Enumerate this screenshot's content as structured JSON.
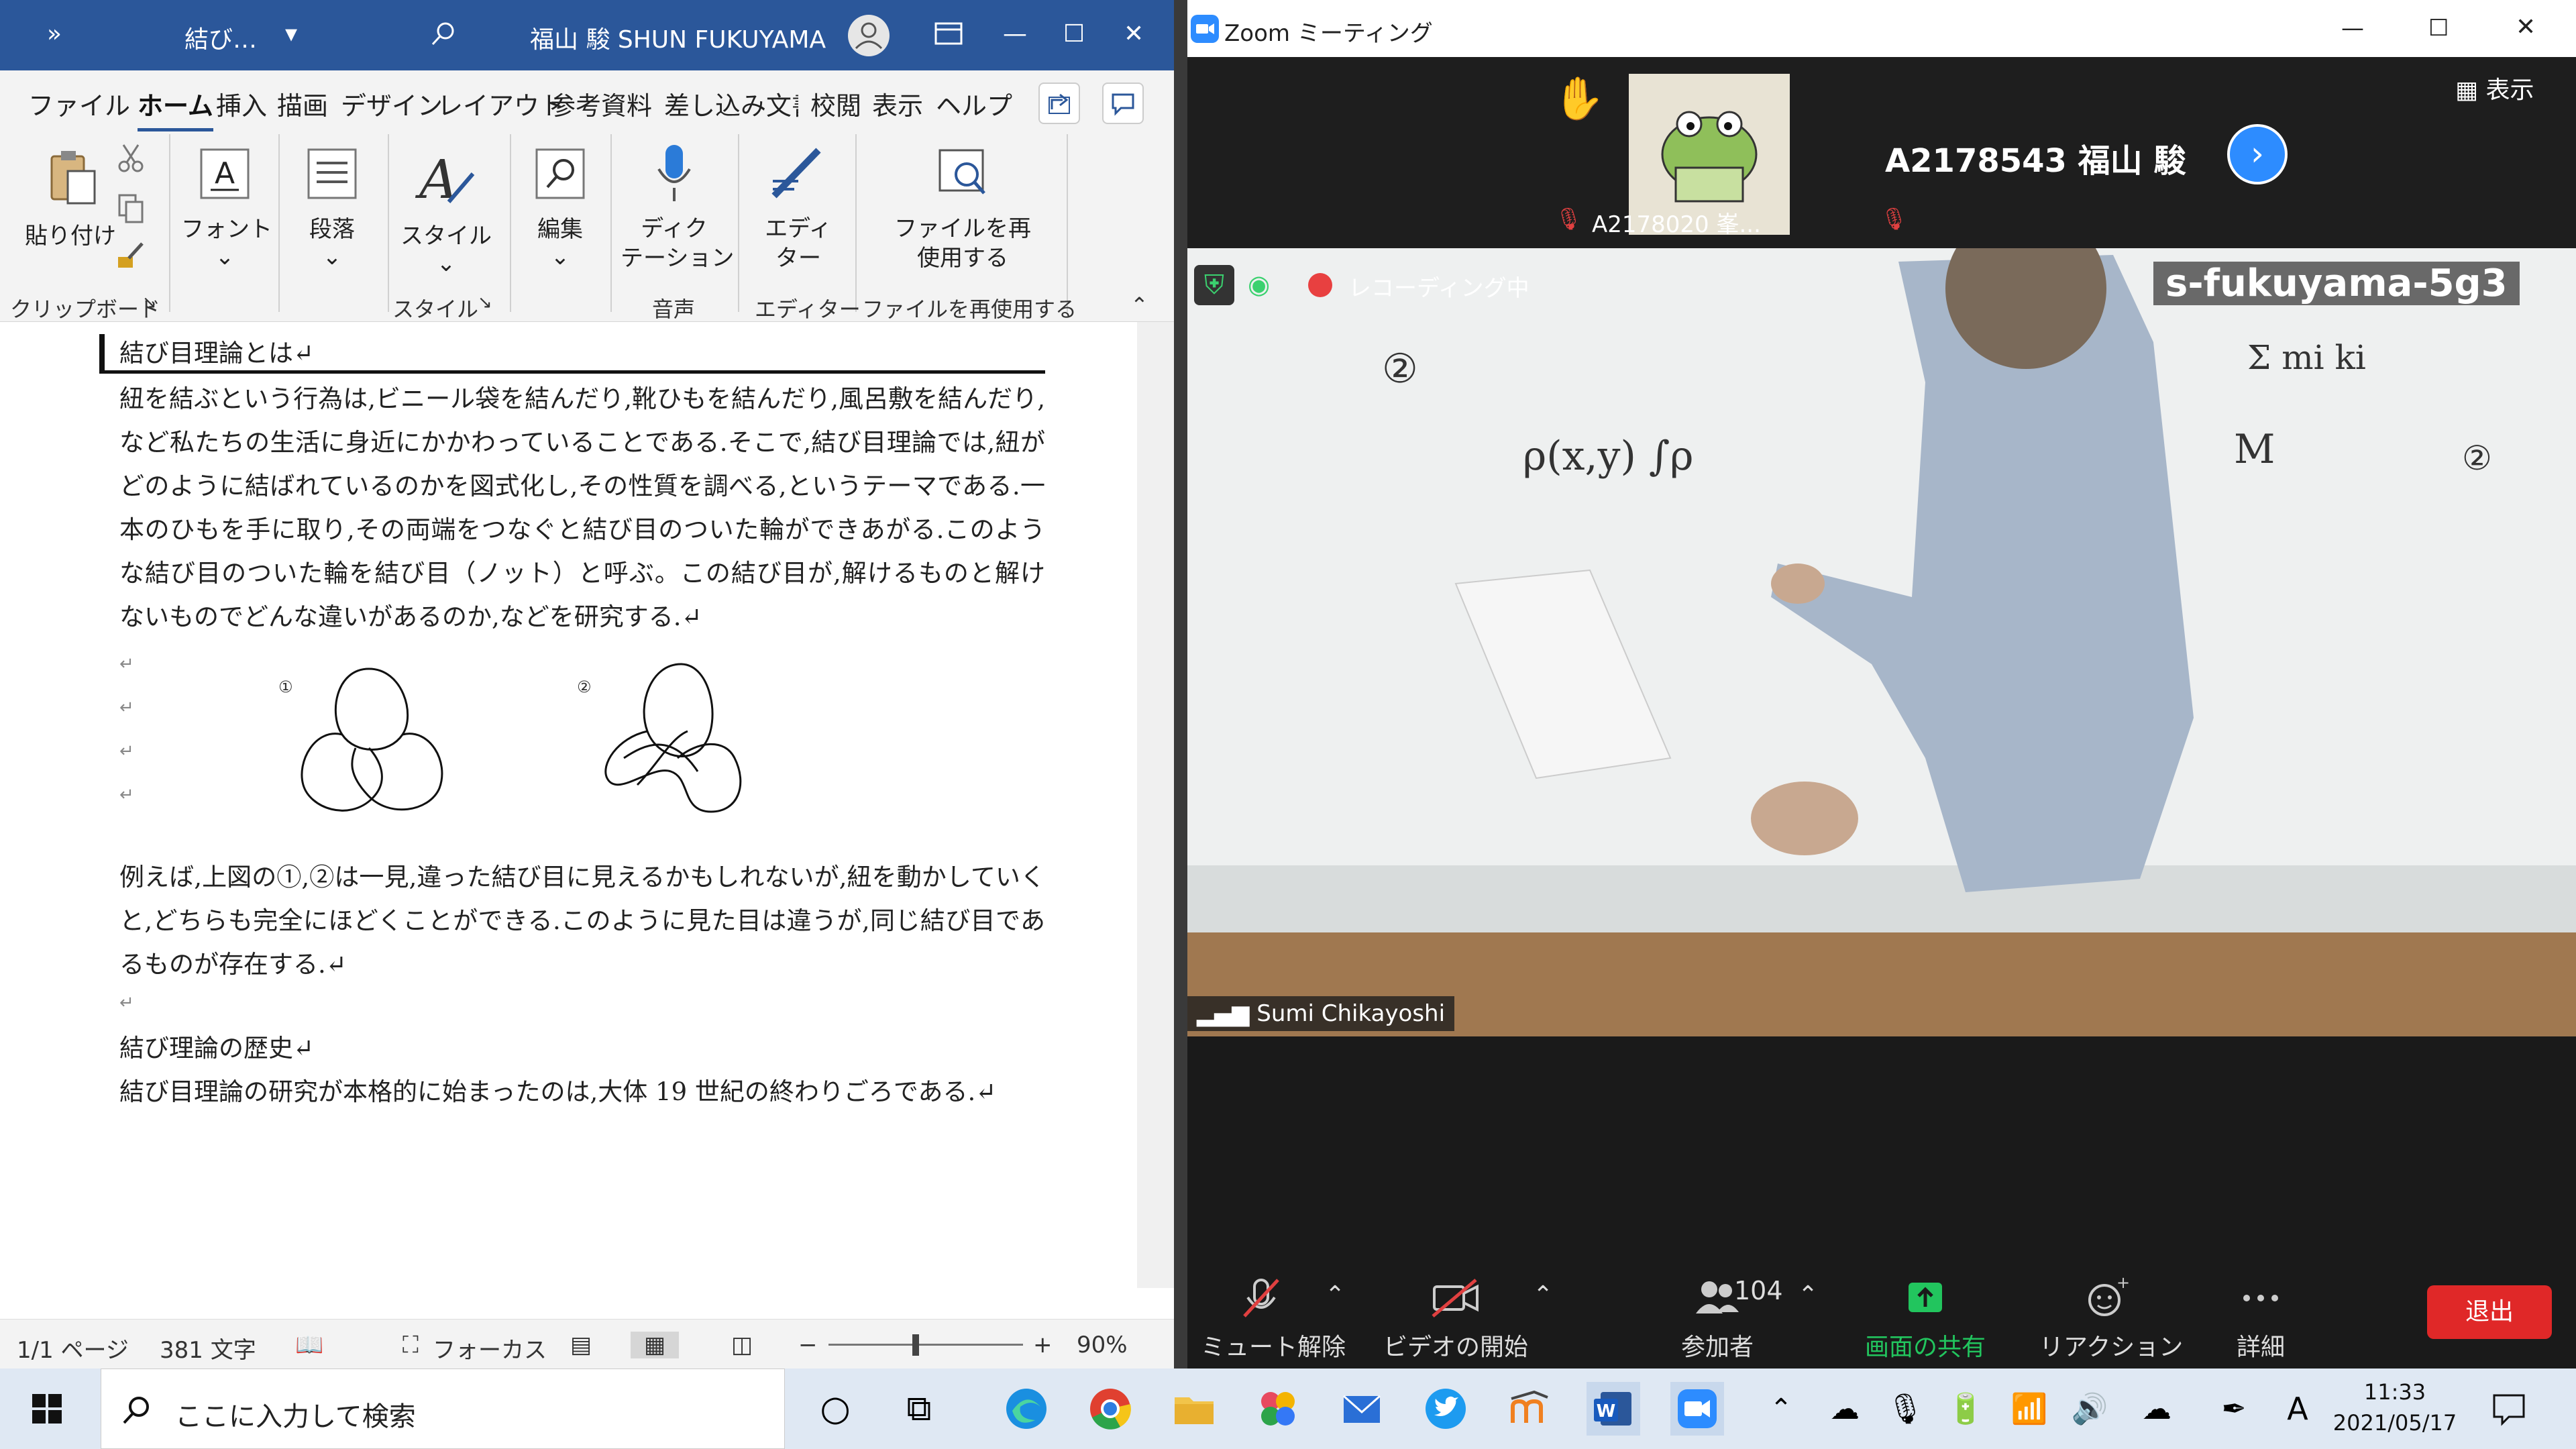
{
  "word": {
    "titlebar": {
      "more": "»",
      "doc_title": "結び…",
      "dropdown": "▾",
      "user": "福山 駿 SHUN FUKUYAMA",
      "min": "—",
      "max": "☐",
      "close": "✕"
    },
    "tabs": [
      "ファイル",
      "ホーム",
      "挿入",
      "描画",
      "デザイン",
      "レイアウト",
      "参考資料",
      "差し込み文書",
      "校閲",
      "表示",
      "ヘルプ"
    ],
    "active_tab": "ホーム",
    "ribbon": {
      "paste": "貼り付け",
      "font": "フォント",
      "paragraph": "段落",
      "styles": "スタイル",
      "edit": "編集",
      "dictation": "ディク\nテーション",
      "editor": "エディ\nター",
      "reuse": "ファイルを再\n使用する",
      "groups": {
        "clipboard": "クリップボード",
        "styles": "スタイル",
        "voice": "音声",
        "editor": "エディター",
        "reuse": "ファイルを再使用する"
      }
    },
    "doc": {
      "heading": "結び目理論とは↵",
      "p1": "紐を結ぶという行為は,ビニール袋を結んだり,靴ひもを結んだり,風呂敷を結んだり,など私たちの生活に身近にかかわっていることである.そこで,結び目理論では,紐がどのように結ばれているのかを図式化し,その性質を調べる,というテーマである.一本のひもを手に取り,その両端をつなぐと結び目のついた輪ができあがる.このような結び目のついた輪を結び目（ノット）と呼ぶ。この結び目が,解けるものと解けないものでどんな違いがあるのか,などを研究する.↵",
      "fig1_label": "①",
      "fig2_label": "②",
      "p2": "例えば,上図の①,②は一見,違った結び目に見えるかもしれないが,紐を動かしていくと,どちらも完全にほどくことができる.このように見た目は違うが,同じ結び目であるものが存在する.↵",
      "h2": "結び理論の歴史↵",
      "p3": "結び目理論の研究が本格的に始まったのは,大体 19 世紀の終わりごろである.↵",
      "para_mark": "↵"
    },
    "status": {
      "page": "1/1 ページ",
      "words": "381 文字",
      "focus": "フォーカス",
      "zoom": "90%"
    }
  },
  "zoom": {
    "title": "Zoom ミーティング",
    "view": "表示",
    "participant1": "A2178020 峯...",
    "participant2": "A2178543 福山 駿",
    "overlay_name": "s-fukuyama-5g3",
    "recording": "レコーディング中",
    "speaker": "Sumi Chikayoshi",
    "toolbar": {
      "mute": "ミュート解除",
      "video": "ビデオの開始",
      "participants": "参加者",
      "participant_count": "104",
      "share": "画面の共有",
      "reaction": "リアクション",
      "more": "詳細",
      "leave": "退出"
    }
  },
  "taskbar": {
    "search_placeholder": "ここに入力して検索",
    "time": "11:33",
    "date": "2021/05/17",
    "ime": "A"
  }
}
